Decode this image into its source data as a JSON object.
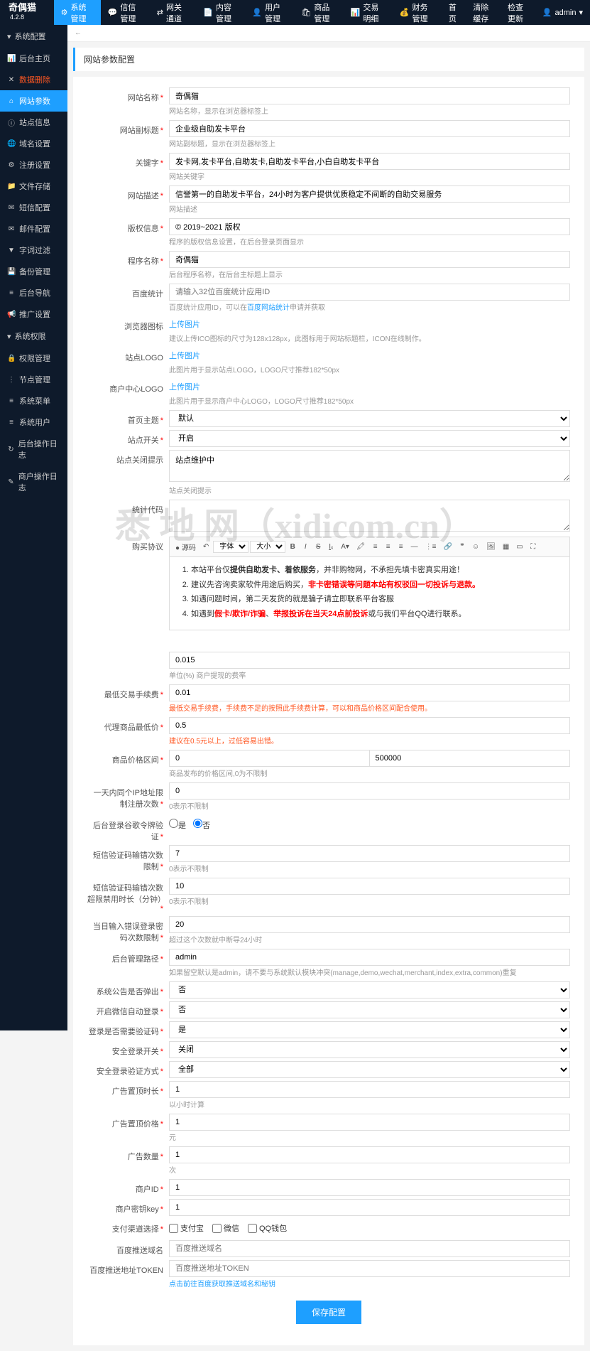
{
  "brand": {
    "name": "奇偶猫",
    "version": "4.2.8"
  },
  "topnav": {
    "items": [
      {
        "label": "系统管理",
        "icon": "⚙"
      },
      {
        "label": "信信管理",
        "icon": "💬"
      },
      {
        "label": "网关通道",
        "icon": "⇄"
      },
      {
        "label": "内容管理",
        "icon": "📄"
      },
      {
        "label": "用户管理",
        "icon": "👤"
      },
      {
        "label": "商品管理",
        "icon": "🛍"
      },
      {
        "label": "交易明细",
        "icon": "📊"
      },
      {
        "label": "财务管理",
        "icon": "💰"
      }
    ],
    "right": [
      {
        "label": "首页"
      },
      {
        "label": "清除缓存"
      },
      {
        "label": "检查更新"
      },
      {
        "label": "admin",
        "icon": "👤"
      }
    ]
  },
  "sidebar": {
    "groups": [
      {
        "title": "系统配置",
        "items": [
          {
            "label": "后台主页",
            "icon": "📊"
          },
          {
            "label": "数据删除",
            "icon": "✕",
            "red": true
          },
          {
            "label": "网站参数",
            "icon": "⌂",
            "active": true
          },
          {
            "label": "站点信息",
            "icon": "ⓘ"
          },
          {
            "label": "域名设置",
            "icon": "🌐"
          },
          {
            "label": "注册设置",
            "icon": "⚙"
          },
          {
            "label": "文件存储",
            "icon": "📁"
          },
          {
            "label": "短信配置",
            "icon": "✉"
          },
          {
            "label": "邮件配置",
            "icon": "✉"
          },
          {
            "label": "字词过滤",
            "icon": "▼"
          },
          {
            "label": "备份管理",
            "icon": "💾"
          },
          {
            "label": "后台导航",
            "icon": "≡"
          },
          {
            "label": "推广设置",
            "icon": "📢"
          }
        ]
      },
      {
        "title": "系统权限",
        "items": [
          {
            "label": "权限管理",
            "icon": "🔒"
          },
          {
            "label": "节点管理",
            "icon": "⋮"
          },
          {
            "label": "系统菜单",
            "icon": "≡"
          },
          {
            "label": "系统用户",
            "icon": "≡"
          },
          {
            "label": "后台操作日志",
            "icon": "↻"
          },
          {
            "label": "商户操作日志",
            "icon": "✎"
          }
        ]
      }
    ]
  },
  "tab": {
    "close": "←"
  },
  "page": {
    "title": "网站参数配置"
  },
  "watermark": "悉 地 网（xidicom.cn）",
  "form": {
    "site_name": {
      "label": "网站名称",
      "value": "奇偶猫",
      "hint": "网站名称，显示在浏览器标签上"
    },
    "site_subtitle": {
      "label": "网站副标题",
      "value": "企业级自助发卡平台",
      "hint": "网站副标题，显示在浏览器标签上"
    },
    "keywords": {
      "label": "关键字",
      "value": "发卡网,发卡平台,自助发卡,自助发卡平台,小白自助发卡平台",
      "hint": "网站关键字"
    },
    "description": {
      "label": "网站描述",
      "value": "信誉第一的自助发卡平台，24小时为客户提供优质稳定不间断的自助交易服务",
      "hint": "网站描述"
    },
    "copyright": {
      "label": "版权信息",
      "value": "© 2019~2021 版权",
      "hint": "程序的版权信息设置，在后台登录页面显示"
    },
    "program_name": {
      "label": "程序名称",
      "value": "奇偶猫",
      "hint": "后台程序名称，在后台主标题上显示"
    },
    "baidu_stat": {
      "label": "百度统计",
      "placeholder": "请输入32位百度统计应用ID",
      "hint_pre": "百度统计应用ID，可以在",
      "hint_link": "百度网站统计",
      "hint_post": "申请并获取"
    },
    "browser_icon": {
      "label": "浏览器图标",
      "btn": "上传图片",
      "hint": "建议上传ICO图标的尺寸为128x128px，此图标用于网站标题栏，ICON在线制作。"
    },
    "site_logo": {
      "label": "站点LOGO",
      "btn": "上传图片",
      "hint": "此图片用于显示站点LOGO，LOGO尺寸推荐182*50px"
    },
    "merchant_logo": {
      "label": "商户中心LOGO",
      "btn": "上传图片",
      "hint": "此图片用于显示商户中心LOGO，LOGO尺寸推荐182*50px"
    },
    "home_theme": {
      "label": "首页主题",
      "value": "默认"
    },
    "site_switch": {
      "label": "站点开关",
      "value": "开启"
    },
    "close_notice": {
      "label": "站点关闭提示",
      "value": "站点维护中",
      "hint": "站点关闭提示"
    },
    "stat_code": {
      "label": "统计代码"
    },
    "agreement": {
      "label": "购买协议"
    },
    "agreement_content": {
      "line1_pre": "本站平台仅",
      "line1_b1": "提供自助发卡、着依服务",
      "line1_mid": "，并非购物网，不承担先填卡密真实用途！",
      "line2_pre": "建议先咨询卖家软件用途后购买，",
      "line2_r": "非卡密错误等问题本站有权驳回一切投诉与退款。",
      "line3": "如遇问题时间，第二天发货的就是骗子请立即联系平台客服",
      "line4_pre": "如遇到",
      "line4_r1": "假卡/欺诈/诈骗",
      "line4_mid": "、",
      "line4_r2": "举报投诉在当天24点前投诉",
      "line4_post": "或与我们平台QQ进行联系。"
    },
    "fee_rate": {
      "value": "0.015",
      "hint": "单位(%) 商户提现的费率"
    },
    "min_fee": {
      "label": "最低交易手续费",
      "value": "0.01",
      "hint": "最低交易手续费，手续费不足的按照此手续费计算，可以和商品价格区间配合使用。"
    },
    "agent_min_price": {
      "label": "代理商品最低价",
      "value": "0.5",
      "hint": "建议在0.5元以上，过低容易出错。"
    },
    "price_range": {
      "label": "商品价格区间",
      "min": "0",
      "max": "500000",
      "hint": "商品发布的价格区间,0为不限制"
    },
    "ip_limit": {
      "label": "一天内同个IP地址限制注册次数",
      "value": "0",
      "hint": "0表示不限制"
    },
    "admin_google": {
      "label": "后台登录谷歌令牌验证",
      "yes": "是",
      "no": "否"
    },
    "sms_wrong": {
      "label": "短信验证码输错次数限制",
      "value": "7",
      "hint": "0表示不限制"
    },
    "sms_ban": {
      "label": "短信验证码输错次数超限禁用时长（分钟）",
      "value": "10",
      "hint": "0表示不限制"
    },
    "pwd_wrong": {
      "label": "当日输入错误登录密码次数限制",
      "value": "20",
      "hint": "超过这个次数就中断导24小时"
    },
    "admin_path": {
      "label": "后台管理路径",
      "value": "admin",
      "hint": "如果留空默认是admin，请不要与系统默认模块冲突(manage,demo,wechat,merchant,index,extra,common)重复"
    },
    "announce_popup": {
      "label": "系统公告是否弹出",
      "value": "否"
    },
    "wechat_login": {
      "label": "开启微信自动登录",
      "value": "否"
    },
    "need_captcha": {
      "label": "登录是否需要验证码",
      "value": "是"
    },
    "safe_login": {
      "label": "安全登录开关",
      "value": "关闭"
    },
    "safe_login_type": {
      "label": "安全登录验证方式",
      "value": "全部"
    },
    "ad_top_time": {
      "label": "广告置顶时长",
      "value": "1",
      "hint": "以小时计算"
    },
    "ad_top_price": {
      "label": "广告置顶价格",
      "value": "1",
      "hint": "元"
    },
    "ad_count": {
      "label": "广告数量",
      "value": "1",
      "hint": "次"
    },
    "merchant_id": {
      "label": "商户ID",
      "value": "1"
    },
    "merchant_key": {
      "label": "商户密钥key",
      "value": "1"
    },
    "pay_channel": {
      "label": "支付渠道选择",
      "alipay": "支付宝",
      "wechat": "微信",
      "qq": "QQ钱包"
    },
    "baidu_push_domain": {
      "label": "百度推送域名",
      "placeholder": "百度推送域名"
    },
    "baidu_push_token": {
      "label": "百度推送地址TOKEN",
      "placeholder": "百度推送地址TOKEN",
      "hint": "点击前往百度获取推送域名和秘钥"
    },
    "submit": "保存配置"
  },
  "editor": {
    "toolbar": {
      "src": "● 源码",
      "undo": "↶",
      "font": "字体",
      "size": "大小"
    }
  }
}
